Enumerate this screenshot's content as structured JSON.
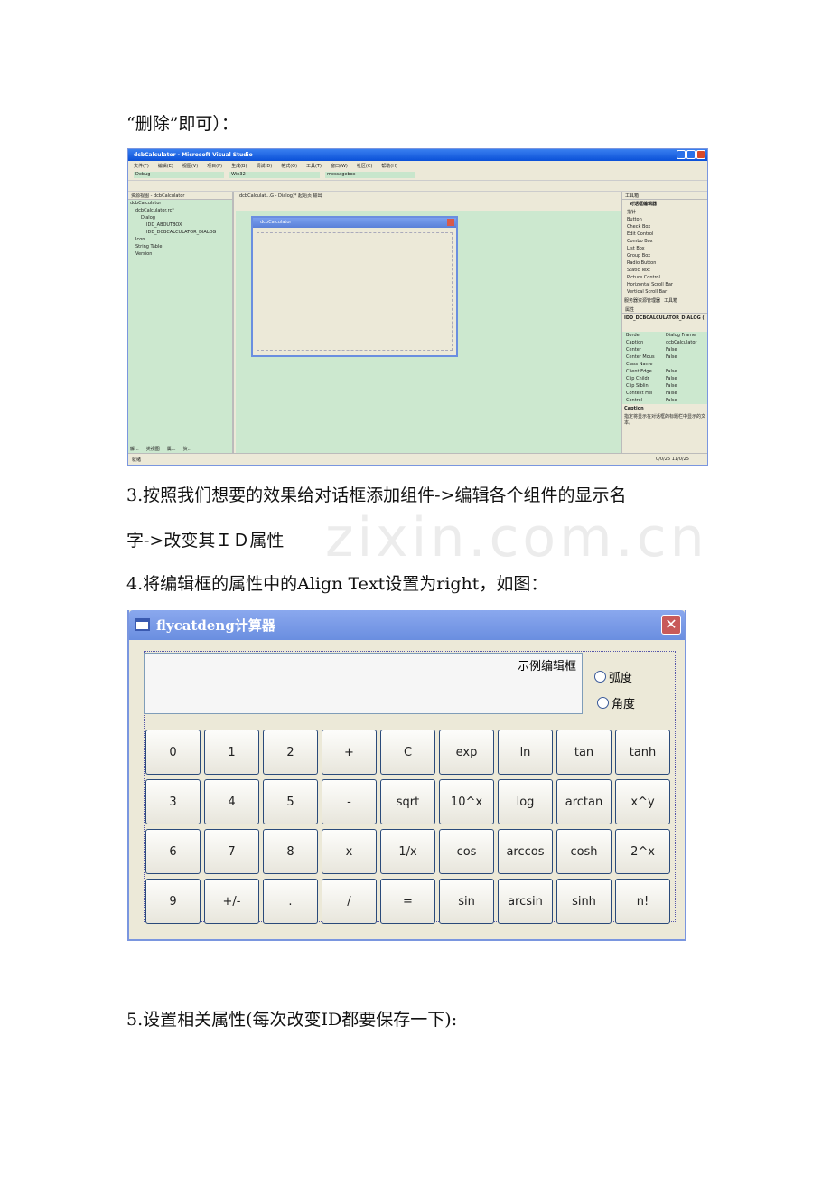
{
  "doc": {
    "line1": "“删除”即可）：",
    "step3a": "3.按照我们想要的效果给对话框添加组件->编辑各个组件的显示名",
    "step3b": "字->改变其ＩＤ属性",
    "step4": "4.将编辑框的属性中的Align  Text设置为right，如图：",
    "step5": "5.设置相关属性(每次改变ID都要保存一下):",
    "watermark": "zixin.com.cn"
  },
  "vs": {
    "title": "dcbCalculator - Microsoft Visual Studio",
    "menu": [
      "文件(F)",
      "编辑(E)",
      "视图(V)",
      "项目(P)",
      "生成(B)",
      "调试(D)",
      "格式(O)",
      "工具(T)",
      "窗口(W)",
      "社区(C)",
      "帮助(H)"
    ],
    "config": "Debug",
    "platform": "Win32",
    "target": "messagebox",
    "left_title": "资源视图 - dcbCalculator",
    "tree": [
      "dcbCalculator",
      "dcbCalculator.rc*",
      "Dialog",
      "IDD_ABOUTBOX",
      "IDD_DCBCALCULATOR_DIALOG",
      "Icon",
      "String Table",
      "Version"
    ],
    "left_tabs": [
      "解...",
      "类视图",
      "属...",
      "资..."
    ],
    "center_tab": "dcbCalculat...G - Dialog]*  起始页  输出",
    "dialog_title": "dcbCalculator",
    "toolbox_title": "工具箱",
    "toolbox_group": "对话框编辑器",
    "toolbox": [
      "指针",
      "Button",
      "Check Box",
      "Edit Control",
      "Combo Box",
      "List Box",
      "Group Box",
      "Radio Button",
      "Static Text",
      "Picture Control",
      "Horizontal Scroll Bar",
      "Vertical Scroll Bar"
    ],
    "toolbox_tabs": [
      "服务器资源管理器",
      "工具箱"
    ],
    "props_title": "属性",
    "props_object": "IDD_DCBCALCULATOR_DIALOG (",
    "props": [
      [
        "Border",
        "Dialog Frame"
      ],
      [
        "Caption",
        "dcbCalculator"
      ],
      [
        "Center",
        "False"
      ],
      [
        "Center Mous",
        "False"
      ],
      [
        "Class Name",
        ""
      ],
      [
        "Client Edge",
        "False"
      ],
      [
        "Clip Childr",
        "False"
      ],
      [
        "Clip Siblin",
        "False"
      ],
      [
        "Context Hel",
        "False"
      ],
      [
        "Control",
        "False"
      ]
    ],
    "desc_title": "Caption",
    "desc": "指定将显示在对话框的标题栏中显示的文本。",
    "status": "就绪",
    "status_right": "0/0/25  11/0/25"
  },
  "calc": {
    "title": "flycatdeng计算器",
    "edit_text": "示例编辑框",
    "radios": [
      "弧度",
      "角度"
    ],
    "buttons": [
      [
        "0",
        "1",
        "2",
        "+",
        "C",
        "exp",
        "ln",
        "tan",
        "tanh"
      ],
      [
        "3",
        "4",
        "5",
        "-",
        "sqrt",
        "10^x",
        "log",
        "arctan",
        "x^y"
      ],
      [
        "6",
        "7",
        "8",
        "x",
        "1/x",
        "cos",
        "arccos",
        "cosh",
        "2^x"
      ],
      [
        "9",
        "+/-",
        ".",
        "/",
        "=",
        "sin",
        "arcsin",
        "sinh",
        "n!"
      ]
    ]
  }
}
